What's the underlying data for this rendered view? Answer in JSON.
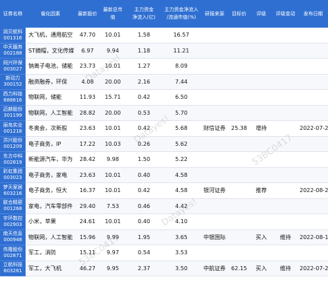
{
  "headers": [
    "证券名称",
    "催化因素",
    "最新股价",
    "最新总市值",
    "主力资金净流入(亿)",
    "主力资金净流入/流通市值(%)",
    "研报来源",
    "目标价",
    "评级",
    "评级变动",
    "发布日期"
  ],
  "header_lines": [
    [
      "证券名称"
    ],
    [
      "催化因素"
    ],
    [
      "最新股价"
    ],
    [
      "最新总市值"
    ],
    [
      "主力资金",
      "净流入(亿)"
    ],
    [
      "主力资金净流入",
      "/流通市值(%)"
    ],
    [
      "研报来源"
    ],
    [
      "目标价"
    ],
    [
      "评级"
    ],
    [
      "评级变动"
    ],
    [
      "发布日期"
    ]
  ],
  "rows": [
    {
      "name": "润贝航科",
      "code": "001316",
      "catalyst": "大飞机，通用航空",
      "price": "47.70",
      "cap": "10.01",
      "inflow": "1.58",
      "ratio": "16.57",
      "source": "",
      "target": "",
      "rating": "",
      "change": "",
      "date": ""
    },
    {
      "name": "中天服务",
      "code": "002188",
      "catalyst": "ST摘帽，文化传媒",
      "price": "6.97",
      "cap": "9.94",
      "inflow": "1.18",
      "ratio": "11.21",
      "source": "",
      "target": "",
      "rating": "",
      "change": "",
      "date": ""
    },
    {
      "name": "同兴环保",
      "code": "003027",
      "catalyst": "钠离子电池，储能",
      "price": "23.73",
      "cap": "10.01",
      "inflow": "1.27",
      "ratio": "8.09",
      "source": "",
      "target": "",
      "rating": "",
      "change": "",
      "date": ""
    },
    {
      "name": "新动力",
      "code": "300152",
      "catalyst": "融资融券，环保",
      "price": "4.08",
      "cap": "20.00",
      "inflow": "2.16",
      "ratio": "7.44",
      "source": "",
      "target": "",
      "rating": "",
      "change": "",
      "date": ""
    },
    {
      "name": "西力科技",
      "code": "688616",
      "catalyst": "物联网，储能",
      "price": "11.93",
      "cap": "15.71",
      "inflow": "0.42",
      "ratio": "6.50",
      "source": "",
      "target": "",
      "rating": "",
      "change": "",
      "date": ""
    },
    {
      "name": "迈赫股份",
      "code": "301199",
      "catalyst": "物联网，人工智能",
      "price": "28.82",
      "cap": "20.00",
      "inflow": "0.53",
      "ratio": "5.70",
      "source": "",
      "target": "",
      "rating": "",
      "change": "",
      "date": ""
    },
    {
      "name": "丽岛实业",
      "code": "001218",
      "catalyst": "冬奥会，次新股",
      "price": "23.63",
      "cap": "10.01",
      "inflow": "0.42",
      "ratio": "5.68",
      "source": "财信证券",
      "target": "25.38",
      "rating": "增持",
      "change": "",
      "date": "2022-07-20"
    },
    {
      "name": "洪兴股份",
      "code": "001209",
      "catalyst": "电子商务，IP",
      "price": "17.22",
      "cap": "10.03",
      "inflow": "0.26",
      "ratio": "5.62",
      "source": "",
      "target": "",
      "rating": "",
      "change": "",
      "date": ""
    },
    {
      "name": "东方中科",
      "code": "002819",
      "catalyst": "新能源汽车，华为",
      "price": "28.42",
      "cap": "9.98",
      "inflow": "1.50",
      "ratio": "5.22",
      "source": "",
      "target": "",
      "rating": "",
      "change": "",
      "date": ""
    },
    {
      "name": "彩虹集团",
      "code": "003023",
      "catalyst": "电子商务，家电",
      "price": "23.63",
      "cap": "10.01",
      "inflow": "0.40",
      "ratio": "4.58",
      "source": "",
      "target": "",
      "rating": "",
      "change": "",
      "date": ""
    },
    {
      "name": "梦天家居",
      "code": "603216",
      "catalyst": "电子商务，恒大",
      "price": "16.37",
      "cap": "10.01",
      "inflow": "0.42",
      "ratio": "4.58",
      "source": "银河证券",
      "target": "",
      "rating": "推荐",
      "change": "",
      "date": "2022-08-29"
    },
    {
      "name": "联合精密",
      "code": "001268",
      "catalyst": "家电，汽车零部件",
      "price": "29.40",
      "cap": "7.53",
      "inflow": "0.46",
      "ratio": "4.42",
      "source": "",
      "target": "",
      "rating": "",
      "change": "",
      "date": ""
    },
    {
      "name": "宇环数控",
      "code": "002903",
      "catalyst": "小米，苹果",
      "price": "24.61",
      "cap": "10.01",
      "inflow": "0.40",
      "ratio": "4.10",
      "source": "",
      "target": "",
      "rating": "",
      "change": "",
      "date": ""
    },
    {
      "name": "南天信息",
      "code": "000948",
      "catalyst": "物联网，人工智能",
      "price": "15.96",
      "cap": "9.99",
      "inflow": "1.95",
      "ratio": "3.65",
      "source": "中银国际",
      "target": "",
      "rating": "买入",
      "change": "维持",
      "date": "2022-08-18"
    },
    {
      "name": "伟隆股份",
      "code": "002871",
      "catalyst": "军工，消防",
      "price": "15.11",
      "cap": "9.97",
      "inflow": "0.54",
      "ratio": "3.53",
      "source": "",
      "target": "",
      "rating": "",
      "change": "",
      "date": ""
    },
    {
      "name": "立航科技",
      "code": "603261",
      "catalyst": "军工，大飞机",
      "price": "46.27",
      "cap": "9.95",
      "inflow": "2.37",
      "ratio": "3.50",
      "source": "中航证券",
      "target": "62.15",
      "rating": "买入",
      "change": "维持",
      "date": "2022-07-29"
    }
  ],
  "watermarks": [
    "Datayes!",
    "Datayes!",
    "Datayes!",
    "53BC0417",
    "53BC0417"
  ]
}
